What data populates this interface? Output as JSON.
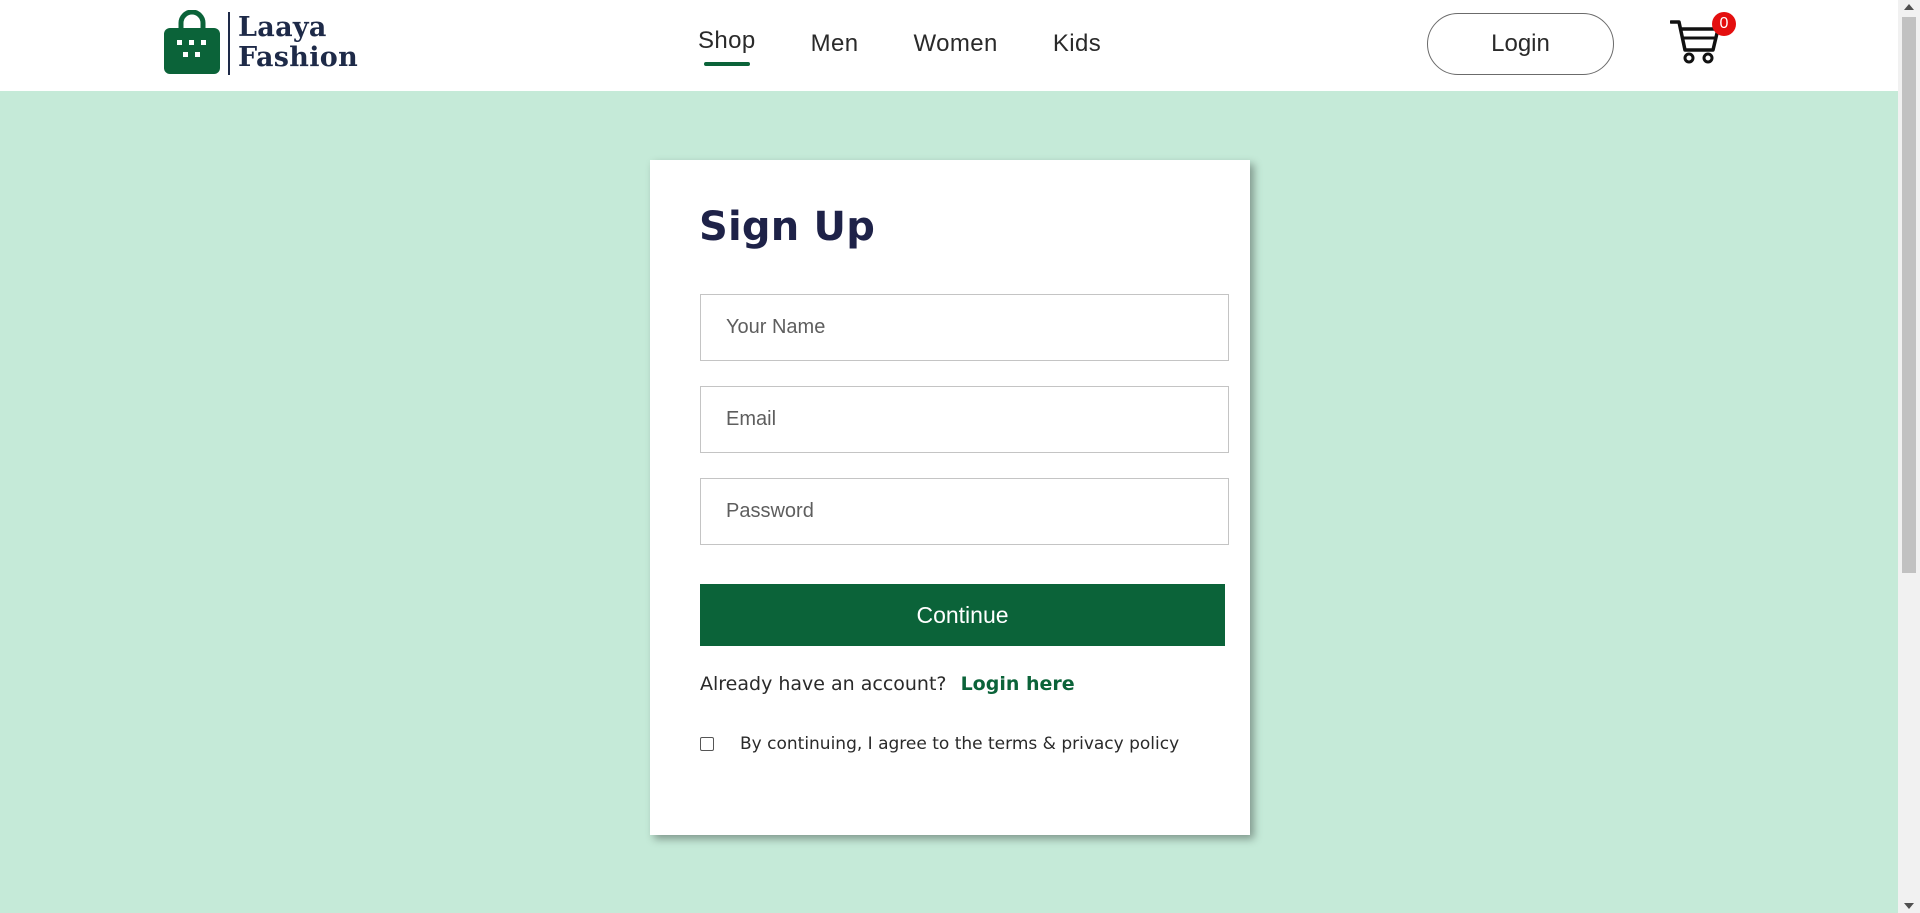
{
  "brand": {
    "line1": "Laaya",
    "line2": "Fashion",
    "logo_icon": "shopping-bag-icon",
    "color": "#0b6339"
  },
  "nav": {
    "items": [
      {
        "label": "Shop",
        "active": true
      },
      {
        "label": "Men",
        "active": false
      },
      {
        "label": "Women",
        "active": false
      },
      {
        "label": "Kids",
        "active": false
      }
    ]
  },
  "header": {
    "login_label": "Login",
    "cart_icon": "cart-icon",
    "cart_count": "0"
  },
  "signup": {
    "title": "Sign Up",
    "name_placeholder": "Your Name",
    "email_placeholder": "Email",
    "password_placeholder": "Password",
    "continue_label": "Continue",
    "account_prompt": "Already have an account?",
    "login_link": "Login here",
    "terms_text": "By continuing, I agree to the terms & privacy policy",
    "terms_checked": false
  },
  "colors": {
    "background": "#c5ead8",
    "primary": "#0b6339",
    "title": "#1e2248",
    "badge": "#e40f0f"
  }
}
